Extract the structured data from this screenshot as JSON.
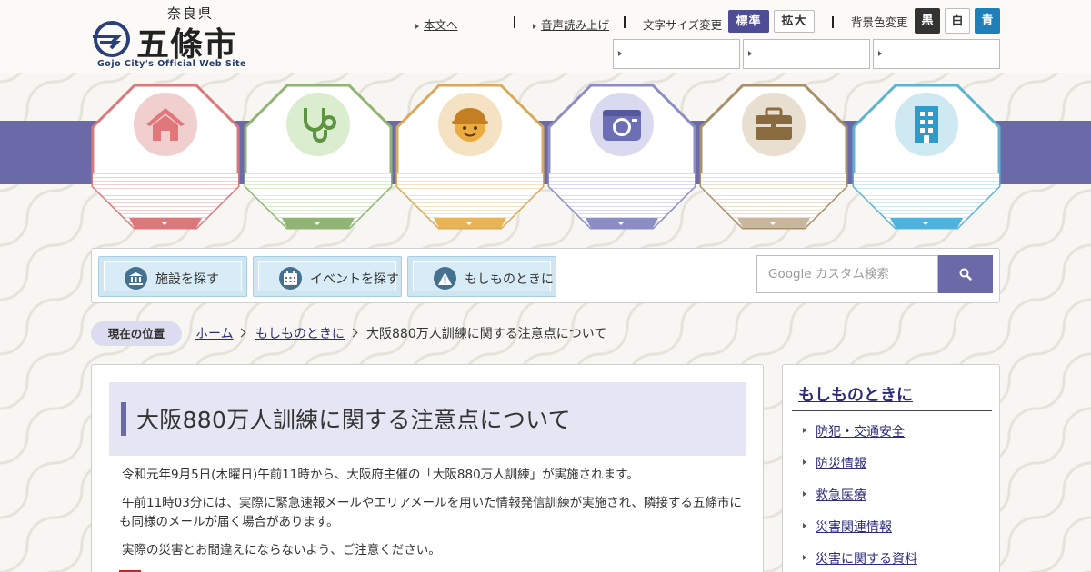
{
  "header": {
    "prefecture": "奈良県",
    "city_name": "五條市",
    "site_subtitle": "Gojo City's Official Web Site",
    "skip_link": "本文へ",
    "speech_link": "音声読み上げ",
    "font_size_label": "文字サイズ変更",
    "font_size_standard": "標準",
    "font_size_large": "拡大",
    "bg_color_label": "背景色変更",
    "bg_black": "黒",
    "bg_white": "白",
    "bg_blue": "青"
  },
  "nav": {
    "items": [
      {
        "icon": "house-icon",
        "color": "#d9797c",
        "light": "#f1cfcf"
      },
      {
        "icon": "stethoscope-icon",
        "color": "#8fb474",
        "light": "#daedcf"
      },
      {
        "icon": "child-face-icon",
        "color": "#d8a95a",
        "light": "#f4e2c2"
      },
      {
        "icon": "camera-icon",
        "color": "#8b8dc4",
        "light": "#d9daef"
      },
      {
        "icon": "briefcase-icon",
        "color": "#a8906a",
        "light": "#e8dfd0"
      },
      {
        "icon": "building-icon",
        "color": "#5eb4d0",
        "light": "#cfe9f2"
      }
    ],
    "band_color": "#6b6aa8"
  },
  "tools": {
    "facility_search": "施設を探す",
    "event_search": "イベントを探す",
    "emergency": "もしものときに",
    "search_placeholder": "Google カスタム検索"
  },
  "breadcrumb": {
    "label": "現在の位置",
    "home": "ホーム",
    "parent": "もしものときに",
    "current": "大阪880万人訓練に関する注意点について"
  },
  "article": {
    "title": "大阪880万人訓練に関する注意点について",
    "p1": "令和元年9月5日(木曜日)午前11時から、大阪府主催の「大阪880万人訓練」が実施されます。",
    "p2": "午前11時03分には、実際に緊急速報メールやエリアメールを用いた情報発信訓練が実施され、隣接する五條市にも同様のメールが届く場合があります。",
    "p3": "実際の災害とお間違えにならないよう、ご注意ください。"
  },
  "sidebar": {
    "title": "もしものときに",
    "items": [
      {
        "label": "防犯・交通安全"
      },
      {
        "label": "防災情報"
      },
      {
        "label": "救急医療"
      },
      {
        "label": "災害関連情報"
      },
      {
        "label": "災害に関する資料"
      }
    ]
  },
  "colors": {
    "accent": "#6b6aa8",
    "link": "#2c2c7a",
    "bg_blue_button": "#1f7fb8"
  }
}
